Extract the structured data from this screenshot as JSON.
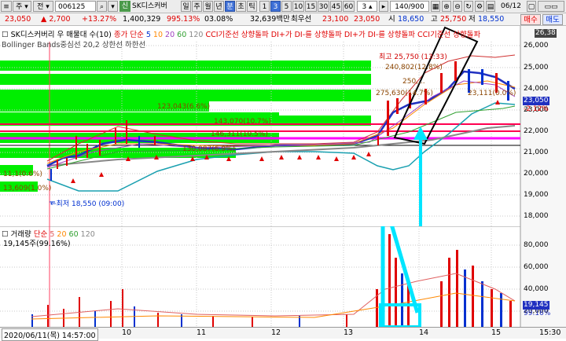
{
  "toolbar": {
    "stock_code": "006125",
    "stock_name": "SK디스커버",
    "period_buttons": [
      "일",
      "주",
      "월",
      "년",
      "분",
      "초",
      "틱"
    ],
    "minute_buttons": [
      "1",
      "3",
      "5",
      "10",
      "15",
      "30",
      "45",
      "60"
    ],
    "interval_value": "3",
    "page_counter": "140/900",
    "date": "06/12"
  },
  "quote": {
    "price": "23,050",
    "change": "▲ 2,700",
    "change_pct": "+13.27%",
    "volume": "1,400,329",
    "vol_ratio": "995.13%",
    "turnover_pct": "03.08%",
    "amount": "32,639백만",
    "best_bid_label": "최우선",
    "bid": "23,100",
    "ask": "23,050",
    "open_label": "시",
    "open": "18,650",
    "high_label": "고",
    "high": "25,750",
    "low_label": "저",
    "low": "18,550",
    "buy_btn": "매수",
    "sell_btn": "매도"
  },
  "price_panel": {
    "legend_line1": "SK디스커버리 우 매물대 수(10)",
    "legend_ma_prefix": "종가 단순",
    "ma_periods": [
      "5",
      "10",
      "20",
      "60",
      "120"
    ],
    "legend_cci_dmi": "CCI기준선 상향돌파   DI+가 DI-를 상향돌파   DI+가 DI-를 상향돌파   CCI기준선 상향돌파",
    "legend_line2": "Bollinger Bands중심선 20,2  상한선  하한선",
    "high_note": "최고 25,750 (13:33)",
    "low_note": "←최저 18,550 (09:00)",
    "volume_profile_labels": [
      {
        "text": "240,802(12.8%)"
      },
      {
        "text": "250,..."
      },
      {
        "text": "275,630(14.7%)"
      },
      {
        "text": "23,111(0.0%)"
      },
      {
        "text": "123,043(6.6%)"
      },
      {
        "text": "143,070(10.7%)"
      },
      {
        "text": "146,311(10.5%)"
      },
      {
        "text": "130,087(6.9%)"
      },
      {
        "text": "11,1(0.6%)"
      },
      {
        "text": "13,609(1.0%)"
      }
    ],
    "y_ticks": [
      "26,000",
      "25,000",
      "24,000",
      "23,000",
      "22,000",
      "21,000",
      "20,000",
      "19,000",
      "18,000"
    ],
    "current_price_tag": "23,050",
    "current_pct_tag": "-2.12%",
    "top_right_tag": "26,38"
  },
  "volume_panel": {
    "legend_title": "거래량",
    "legend_ma_prefix": "단순",
    "ma_periods": [
      "5",
      "20",
      "60",
      "120"
    ],
    "legend_value": "19,145주(99.16%)",
    "y_ticks": [
      "80,000",
      "60,000",
      "40,000",
      "20,000"
    ],
    "current_vol_tag": "19,145",
    "current_vol_pct_tag": "99.16%"
  },
  "xaxis": {
    "cursor_label": "2020/06/11(목) 14:57:00",
    "day_labels": [
      "10",
      "11",
      "12",
      "13",
      "14",
      "15"
    ],
    "time_label": "15:30"
  },
  "colors": {
    "candle_up": "#e00000",
    "candle_down": "#0030d0",
    "vp_bar": "#00ee00",
    "hline_red": "#ff0050",
    "hline_magenta": "#ff00ff",
    "annot_cyan": "#00e5ff"
  }
}
